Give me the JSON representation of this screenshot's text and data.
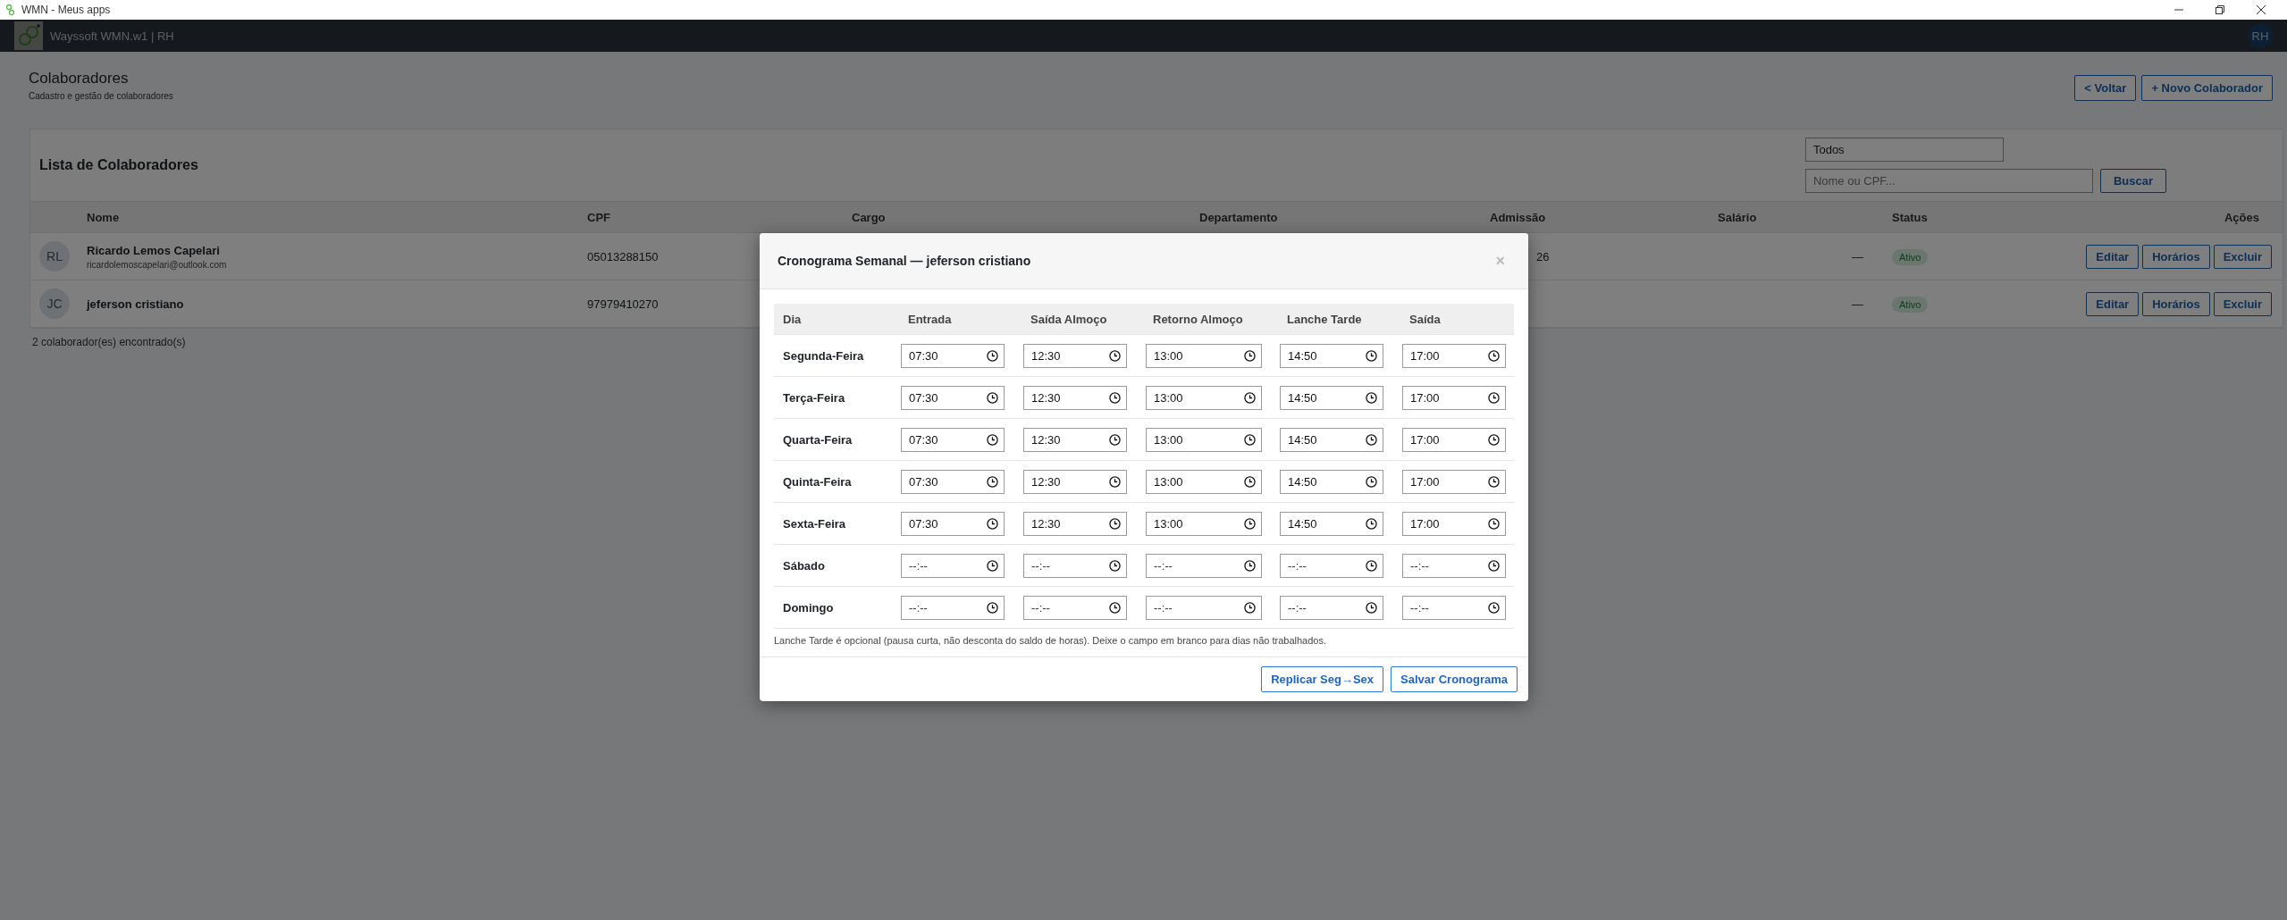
{
  "titlebar": {
    "title": "WMN - Meus apps"
  },
  "appbar": {
    "brand": "Wayssoft WMN.w1 | RH",
    "user_initials": "RH"
  },
  "page": {
    "title": "Colaboradores",
    "subtitle": "Cadastro e gestão de colaboradores",
    "buttons": [
      "< Voltar",
      "+ Novo Colaborador"
    ]
  },
  "list": {
    "title": "Lista de Colaboradores",
    "filter": {
      "value": "Todos"
    },
    "search": {
      "placeholder": "Nome ou CPF..."
    },
    "search_button": "Buscar",
    "columns": [
      "Nome",
      "CPF",
      "Cargo",
      "Departamento",
      "Admissão",
      "Salário",
      "Status",
      "Ações"
    ],
    "rows": [
      {
        "initials": "RL",
        "name": "Ricardo Lemos Capelari",
        "email": "ricardolemoscapelari@outlook.com",
        "cpf": "05013288150",
        "admissao": "26",
        "salario": "—",
        "status": "Ativo",
        "actions": [
          "Editar",
          "Horários",
          "Excluir"
        ]
      },
      {
        "initials": "JC",
        "name": "jeferson cristiano",
        "cpf": "97979410270",
        "salario": "—",
        "status": "Ativo",
        "actions": [
          "Editar",
          "Horários",
          "Excluir"
        ]
      }
    ],
    "count": "2 colaborador(es) encontrado(s)"
  },
  "modal": {
    "title": "Cronograma Semanal — jeferson cristiano",
    "close": "×",
    "columns": [
      "Dia",
      "Entrada",
      "Saída Almoço",
      "Retorno Almoço",
      "Lanche Tarde",
      "Saída"
    ],
    "days": [
      {
        "day": "Segunda-Feira",
        "times": [
          {
            "value": "07:30"
          },
          {
            "value": "12:30"
          },
          {
            "value": "13:00"
          },
          {
            "value": "14:50"
          },
          {
            "value": "17:00"
          }
        ]
      },
      {
        "day": "Terça-Feira",
        "times": [
          {
            "value": "07:30"
          },
          {
            "value": "12:30"
          },
          {
            "value": "13:00"
          },
          {
            "value": "14:50"
          },
          {
            "value": "17:00"
          }
        ]
      },
      {
        "day": "Quarta-Feira",
        "times": [
          {
            "value": "07:30"
          },
          {
            "value": "12:30"
          },
          {
            "value": "13:00"
          },
          {
            "value": "14:50"
          },
          {
            "value": "17:00"
          }
        ]
      },
      {
        "day": "Quinta-Feira",
        "times": [
          {
            "value": "07:30"
          },
          {
            "value": "12:30"
          },
          {
            "value": "13:00"
          },
          {
            "value": "14:50"
          },
          {
            "value": "17:00"
          }
        ]
      },
      {
        "day": "Sexta-Feira",
        "times": [
          {
            "value": "07:30"
          },
          {
            "value": "12:30"
          },
          {
            "value": "13:00"
          },
          {
            "value": "14:50"
          },
          {
            "value": "17:00"
          }
        ]
      },
      {
        "day": "Sábado",
        "times": [
          {
            "placeholder": "--:--"
          },
          {
            "placeholder": "--:--"
          },
          {
            "placeholder": "--:--"
          },
          {
            "placeholder": "--:--"
          },
          {
            "placeholder": "--:--"
          }
        ]
      },
      {
        "day": "Domingo",
        "times": [
          {
            "placeholder": "--:--"
          },
          {
            "placeholder": "--:--"
          },
          {
            "placeholder": "--:--"
          },
          {
            "placeholder": "--:--"
          },
          {
            "placeholder": "--:--"
          }
        ]
      }
    ],
    "note": "Lanche Tarde é opcional (pausa curta, não desconta do saldo de horas). Deixe o campo em branco para dias não trabalhados.",
    "buttons": [
      "Replicar Seg→Sex",
      "Salvar Cronograma"
    ]
  }
}
